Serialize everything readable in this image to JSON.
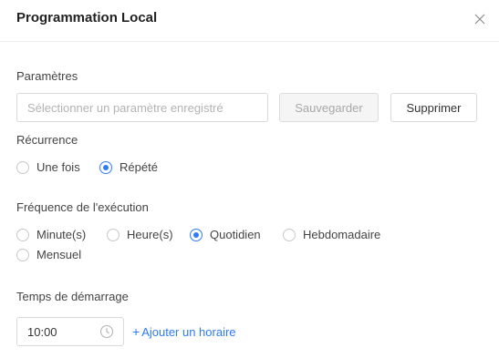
{
  "dialog": {
    "title": "Programmation Local",
    "close_icon": "close-icon"
  },
  "params": {
    "label": "Paramètres",
    "placeholder": "Sélectionner un paramètre enregistré",
    "value": "",
    "save_label": "Sauvegarder",
    "delete_label": "Supprimer"
  },
  "recurrence": {
    "label": "Récurrence",
    "options": [
      "Une fois",
      "Répété"
    ],
    "selected": "Répété"
  },
  "frequency": {
    "label": "Fréquence de l'exécution",
    "options": [
      "Minute(s)",
      "Heure(s)",
      "Quotidien",
      "Hebdomadaire",
      "Mensuel"
    ],
    "selected": "Quotidien"
  },
  "start_time": {
    "label": "Temps de démarrage",
    "value": "10:00",
    "icon": "clock-icon",
    "add_label": "Ajouter un horaire"
  },
  "colors": {
    "accent": "#2f7bf5",
    "border": "#d9d9d9",
    "disabled_text": "#a8a8a8"
  }
}
